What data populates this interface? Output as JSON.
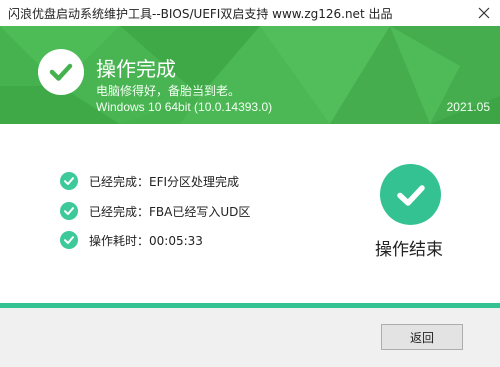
{
  "window": {
    "title": "闪浪优盘启动系统维护工具--BIOS/UEFI双启支持 www.zg126.net 出品"
  },
  "header": {
    "title": "操作完成",
    "subtitle": "电脑修得好，备胎当到老。",
    "os_info": "Windows 10 64bit (10.0.14393.0)",
    "version": "2021.05",
    "color": "#46b14f"
  },
  "status": {
    "items": [
      "已经完成：EFI分区处理完成",
      "已经完成：FBA已经写入UD区",
      "操作耗时：00:05:33"
    ],
    "check_color": "#3ec99a"
  },
  "result": {
    "label": "操作结束",
    "icon": "check-circle-icon",
    "color": "#35c293"
  },
  "footer": {
    "back_label": "返回"
  }
}
